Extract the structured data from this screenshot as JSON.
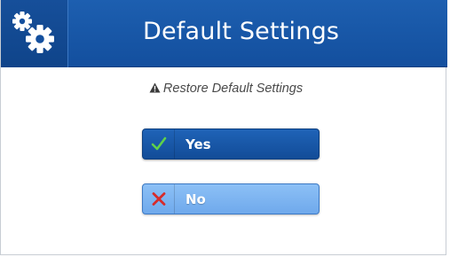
{
  "header": {
    "title": "Default Settings",
    "icon": "gears-icon"
  },
  "dialog": {
    "message": "Restore Default Settings",
    "message_icon": "warning-icon"
  },
  "buttons": {
    "yes": {
      "label": "Yes",
      "icon": "check-icon",
      "icon_color": "#5fd14a"
    },
    "no": {
      "label": "No",
      "icon": "x-icon",
      "icon_color": "#d62b2b"
    }
  },
  "colors": {
    "header": "#1a58a8",
    "yes_button": "#1a58a8",
    "no_button": "#80b6f1"
  }
}
